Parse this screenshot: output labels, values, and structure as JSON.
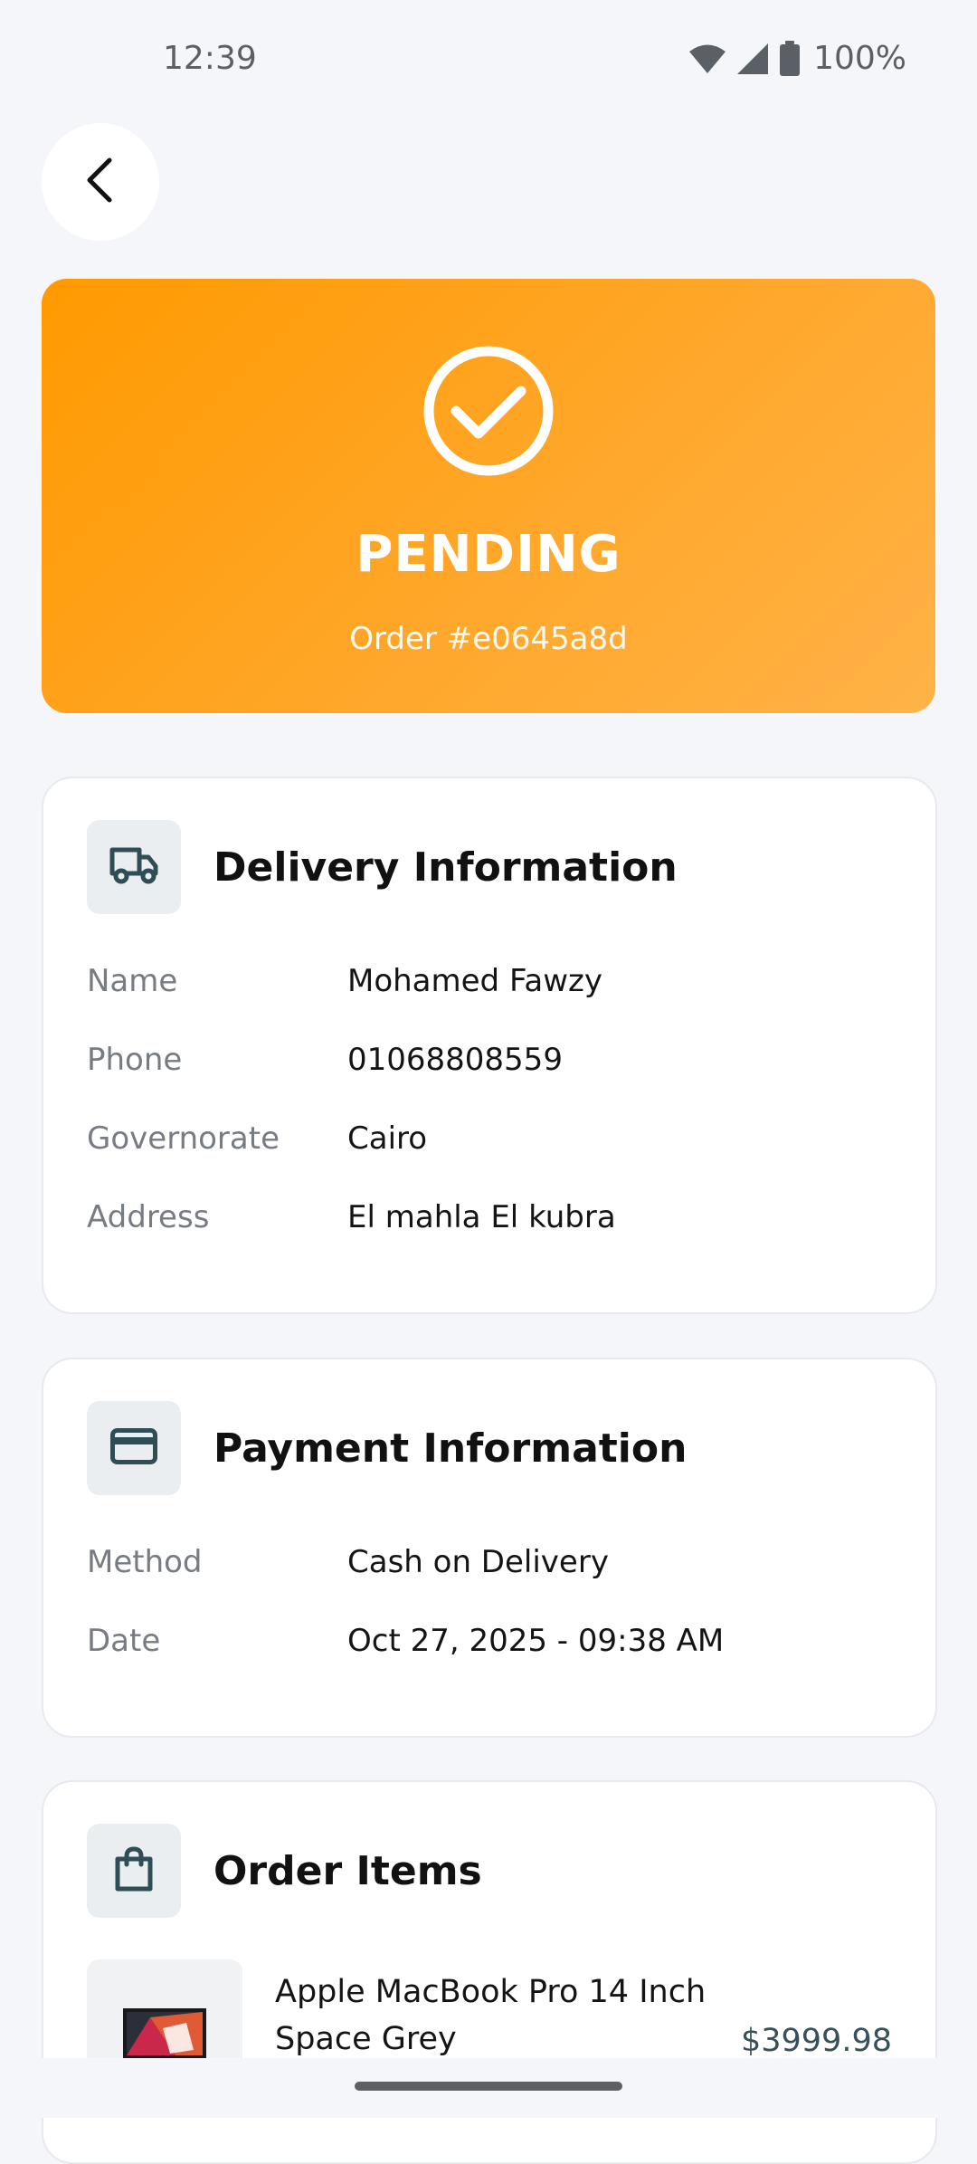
{
  "status_bar": {
    "time": "12:39",
    "battery": "100%",
    "icons": [
      "wifi-icon",
      "signal-icon",
      "battery-icon"
    ]
  },
  "nav": {
    "back_icon": "chevron-left-icon"
  },
  "order_status": {
    "status": "PENDING",
    "order_number": "Order #e0645a8d",
    "icon": "check-circle-icon",
    "color": "#ff9a00"
  },
  "delivery": {
    "title": "Delivery Information",
    "icon": "truck-icon",
    "rows": [
      {
        "label": "Name",
        "value": "Mohamed Fawzy"
      },
      {
        "label": "Phone",
        "value": "01068808559"
      },
      {
        "label": "Governorate",
        "value": "Cairo"
      },
      {
        "label": "Address",
        "value": "El mahla El kubra"
      }
    ]
  },
  "payment": {
    "title": "Payment Information",
    "icon": "credit-card-icon",
    "rows": [
      {
        "label": "Method",
        "value": "Cash on Delivery"
      },
      {
        "label": "Date",
        "value": "Oct 27, 2025 - 09:38 AM"
      }
    ]
  },
  "order_items": {
    "title": "Order Items",
    "icon": "shopping-bag-icon",
    "items": [
      {
        "name": "Apple MacBook Pro 14 Inch Space Grey",
        "price": "$3999.98"
      }
    ]
  },
  "theme": {
    "accent": "#ff9a00",
    "icon_color": "#2f4d55",
    "price_color": "#385059"
  }
}
